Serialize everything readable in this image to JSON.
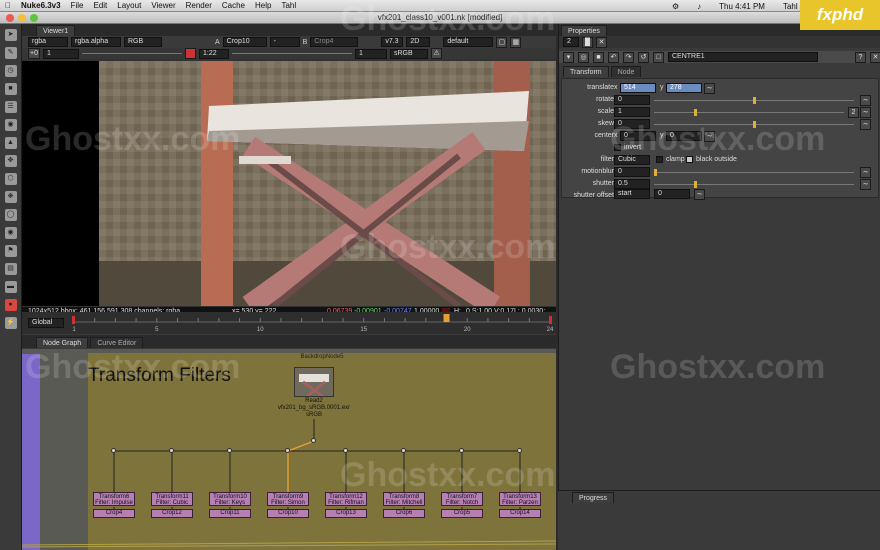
{
  "menubar": {
    "app": "Nuke6.3v3",
    "items": [
      "File",
      "Edit",
      "Layout",
      "Viewer",
      "Render",
      "Cache",
      "Help",
      "Tahl"
    ],
    "clock": "Thu 4:41 PM",
    "user": "Tahl Niran"
  },
  "window": {
    "title": "vfx201_class10_v001.nk [modified]"
  },
  "logo": {
    "text": "fxphd",
    "color": "#e8c52a"
  },
  "watermark": "Ghostxx.com",
  "toolbar": {
    "tools": [
      "pointer-icon",
      "paint-icon",
      "clock-icon",
      "color-icon",
      "channel-icon",
      "filter-icon",
      "merge-icon",
      "transform-icon",
      "3d-icon",
      "particle-icon",
      "keyer-icon",
      "view-icon",
      "metadata-icon",
      "toolset-icon",
      "other-icon",
      "furnace-icon",
      "plugin-icon"
    ]
  },
  "viewer": {
    "tab": "Viewer1",
    "channels": "rgba",
    "alpha": "rgba.alpha",
    "colorspace_display": "RGB",
    "a_label": "A",
    "a_input": "Crop10",
    "a_dash": "-",
    "b_label": "B",
    "b_input": "Crop4",
    "zoom": "v7.3",
    "mode": "2D",
    "lut": "default",
    "gain_label": "+0",
    "gain": "1",
    "frame_ratio": "1:22",
    "proxy": "1",
    "display_lut": "sRGB",
    "info": {
      "format": "1024x512 bbox: 461 156 591 308 channels: rgba",
      "coords": "x= 530 y= 222",
      "r": "0.06739",
      "g": "-0.00901",
      "b": "-0.00747",
      "a": "1.00000",
      "h": "H:",
      "hsv": "0 S:1.00 V:0.17",
      "l": "L: 0.0030:"
    },
    "transport": {
      "frame": "19",
      "step": "10",
      "fps_label": "fps",
      "fps": "24"
    },
    "timeline": {
      "mode": "Global",
      "ticks": [
        "1",
        "5",
        "10",
        "15",
        "20",
        "24"
      ],
      "current": 19
    }
  },
  "nodegraph": {
    "tabs": [
      "Node Graph",
      "Curve Editor"
    ],
    "backdrop_name": "BackdropNode5",
    "backdrop_title": "Transform Filters",
    "read_node": {
      "name": "Read2",
      "file": "vfx201_bg_sRGB.0001.exr",
      "colorspace": "sRGB"
    },
    "transforms": [
      {
        "name": "Transform6",
        "filter": "Filter: Impulse",
        "crop": "Crop4"
      },
      {
        "name": "Transform11",
        "filter": "Filter: Cubic",
        "crop": "Crop12"
      },
      {
        "name": "Transform10",
        "filter": "Filter: Keys",
        "crop": "Crop11"
      },
      {
        "name": "Transform9",
        "filter": "Filter: Simon",
        "crop": "Crop10"
      },
      {
        "name": "Transform12",
        "filter": "Filter: Rifman",
        "crop": "Crop13"
      },
      {
        "name": "Transform8",
        "filter": "Filter: Mitchell",
        "crop": "Crop6"
      },
      {
        "name": "Transform7",
        "filter": "Filter: Notch",
        "crop": "Crop5"
      },
      {
        "name": "Transform13",
        "filter": "Filter: Parzen",
        "crop": "Crop14"
      }
    ]
  },
  "properties": {
    "title": "Properties",
    "count": "2",
    "node_name": "CENTRE1",
    "tabs": [
      "Transform",
      "Node"
    ],
    "translate": {
      "label": "translate",
      "x_label": "x",
      "x": "514",
      "y_label": "y",
      "y": "278"
    },
    "rotate": {
      "label": "rotate",
      "value": "0"
    },
    "scale": {
      "label": "scale",
      "value": "1",
      "dim": "2"
    },
    "skew": {
      "label": "skew",
      "value": "0"
    },
    "center": {
      "label": "center",
      "x_label": "x",
      "x": "0",
      "y_label": "y",
      "y": "0"
    },
    "invert_label": "invert",
    "filter": {
      "label": "filter",
      "value": "Cubic",
      "clamp": "clamp",
      "black_outside": "black outside"
    },
    "motionblur": {
      "label": "motionblur",
      "value": "0"
    },
    "shutter": {
      "label": "shutter",
      "value": "0.5"
    },
    "shutter_offset": {
      "label": "shutter offset",
      "value": "start",
      "extra": "0"
    }
  },
  "progress": {
    "title": "Progress"
  }
}
